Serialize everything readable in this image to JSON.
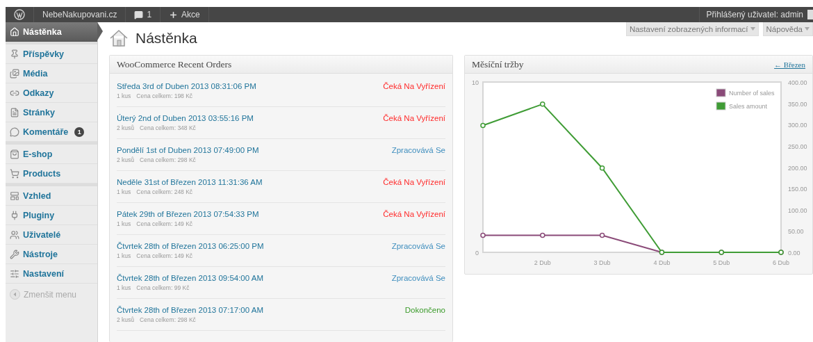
{
  "admin_bar": {
    "site": "NebeNakupovani.cz",
    "comments": "1",
    "new": "Akce",
    "account": "Přihlášený uživatel: admin"
  },
  "sidebar": {
    "groups": [
      [
        {
          "label": "Nástěnka",
          "selected": true
        }
      ],
      [
        {
          "label": "Příspěvky",
          "selected": false
        },
        {
          "label": "Média",
          "selected": false
        },
        {
          "label": "Odkazy",
          "selected": false
        },
        {
          "label": "Stránky",
          "selected": false
        },
        {
          "label": "Komentáře",
          "selected": false,
          "badge": "1"
        }
      ],
      [
        {
          "label": "E-shop",
          "selected": false
        },
        {
          "label": "Products",
          "selected": false
        }
      ],
      [
        {
          "label": "Vzhled",
          "selected": false
        },
        {
          "label": "Pluginy",
          "selected": false
        },
        {
          "label": "Uživatelé",
          "selected": false
        },
        {
          "label": "Nástroje",
          "selected": false
        },
        {
          "label": "Nastavení",
          "selected": false
        }
      ]
    ],
    "collapse": "Zmenšit menu"
  },
  "screen_buttons": [
    "Nastavení zobrazených informací",
    "Nápověda"
  ],
  "page_title": "Nástěnka",
  "recent_orders": {
    "title": "WooCommerce Recent Orders",
    "orders": [
      {
        "date": "Středa 3rd of Duben 2013 08:31:06 PM",
        "items": "1 kus",
        "total": "Cena celkem: 198 Kč",
        "status": "Čeká Na Vyřízení",
        "color": "#ff2a2a"
      },
      {
        "date": "Úterý 2nd of Duben 2013 03:55:16 PM",
        "items": "2 kusů",
        "total": "Cena celkem: 348 Kč",
        "status": "Čeká Na Vyřízení",
        "color": "#ff2a2a"
      },
      {
        "date": "Pondělí 1st of Duben 2013 07:49:00 PM",
        "items": "2 kusů",
        "total": "Cena celkem: 298 Kč",
        "status": "Zpracovává Se",
        "color": "#3d8dbd"
      },
      {
        "date": "Neděle 31st of Březen 2013 11:31:36 AM",
        "items": "1 kus",
        "total": "Cena celkem: 248 Kč",
        "status": "Čeká Na Vyřízení",
        "color": "#ff2a2a"
      },
      {
        "date": "Pátek 29th of Březen 2013 07:54:33 PM",
        "items": "1 kus",
        "total": "Cena celkem: 149 Kč",
        "status": "Čeká Na Vyřízení",
        "color": "#ff2a2a"
      },
      {
        "date": "Čtvrtek 28th of Březen 2013 06:25:00 PM",
        "items": "1 kus",
        "total": "Cena celkem: 149 Kč",
        "status": "Zpracovává Se",
        "color": "#3d8dbd"
      },
      {
        "date": "Čtvrtek 28th of Březen 2013 09:54:00 AM",
        "items": "1 kus",
        "total": "Cena celkem: 99 Kč",
        "status": "Zpracovává Se",
        "color": "#3d8dbd"
      },
      {
        "date": "Čtvrtek 28th of Březen 2013 07:17:00 AM",
        "items": "2 kusů",
        "total": "Cena celkem: 298 Kč",
        "status": "Dokončeno",
        "color": "#3a9a2a"
      }
    ]
  },
  "sales_chart": {
    "title": "Měsíční tržby",
    "nav_link": "← Březen",
    "chart_data": {
      "type": "line",
      "x": [
        1,
        2,
        3,
        4,
        5,
        6
      ],
      "xticks": [
        {
          "value": 2,
          "label": "2 Dub"
        },
        {
          "value": 3,
          "label": "3 Dub"
        },
        {
          "value": 4,
          "label": "4 Dub"
        },
        {
          "value": 5,
          "label": "5 Dub"
        },
        {
          "value": 6,
          "label": "6 Dub"
        }
      ],
      "legend": "top right",
      "xlim": [
        1,
        6
      ],
      "ylim": [
        0,
        10
      ],
      "yticks": [
        {
          "value": 0,
          "label": "0"
        },
        {
          "value": 10,
          "label": "10"
        }
      ],
      "y2lim": [
        0,
        400
      ],
      "y2ticks": [
        {
          "value": 0,
          "label": "0.00"
        },
        {
          "value": 50,
          "label": "50.00"
        },
        {
          "value": 100,
          "label": "100.00"
        },
        {
          "value": 150,
          "label": "150.00"
        },
        {
          "value": 200,
          "label": "200.00"
        },
        {
          "value": 250,
          "label": "250.00"
        },
        {
          "value": 300,
          "label": "300.00"
        },
        {
          "value": 350,
          "label": "350.00"
        },
        {
          "value": 400,
          "label": "400.00"
        }
      ],
      "series": [
        {
          "name": "Number of sales",
          "color": "#8a4a78",
          "marker": "circle",
          "values": [
            1,
            1,
            1,
            0,
            0,
            0
          ]
        },
        {
          "name": "Sales amount",
          "color": "#3f9c35",
          "marker": "circle",
          "axis": "y2",
          "values": [
            298,
            348,
            198,
            0,
            0,
            0
          ]
        }
      ]
    }
  }
}
